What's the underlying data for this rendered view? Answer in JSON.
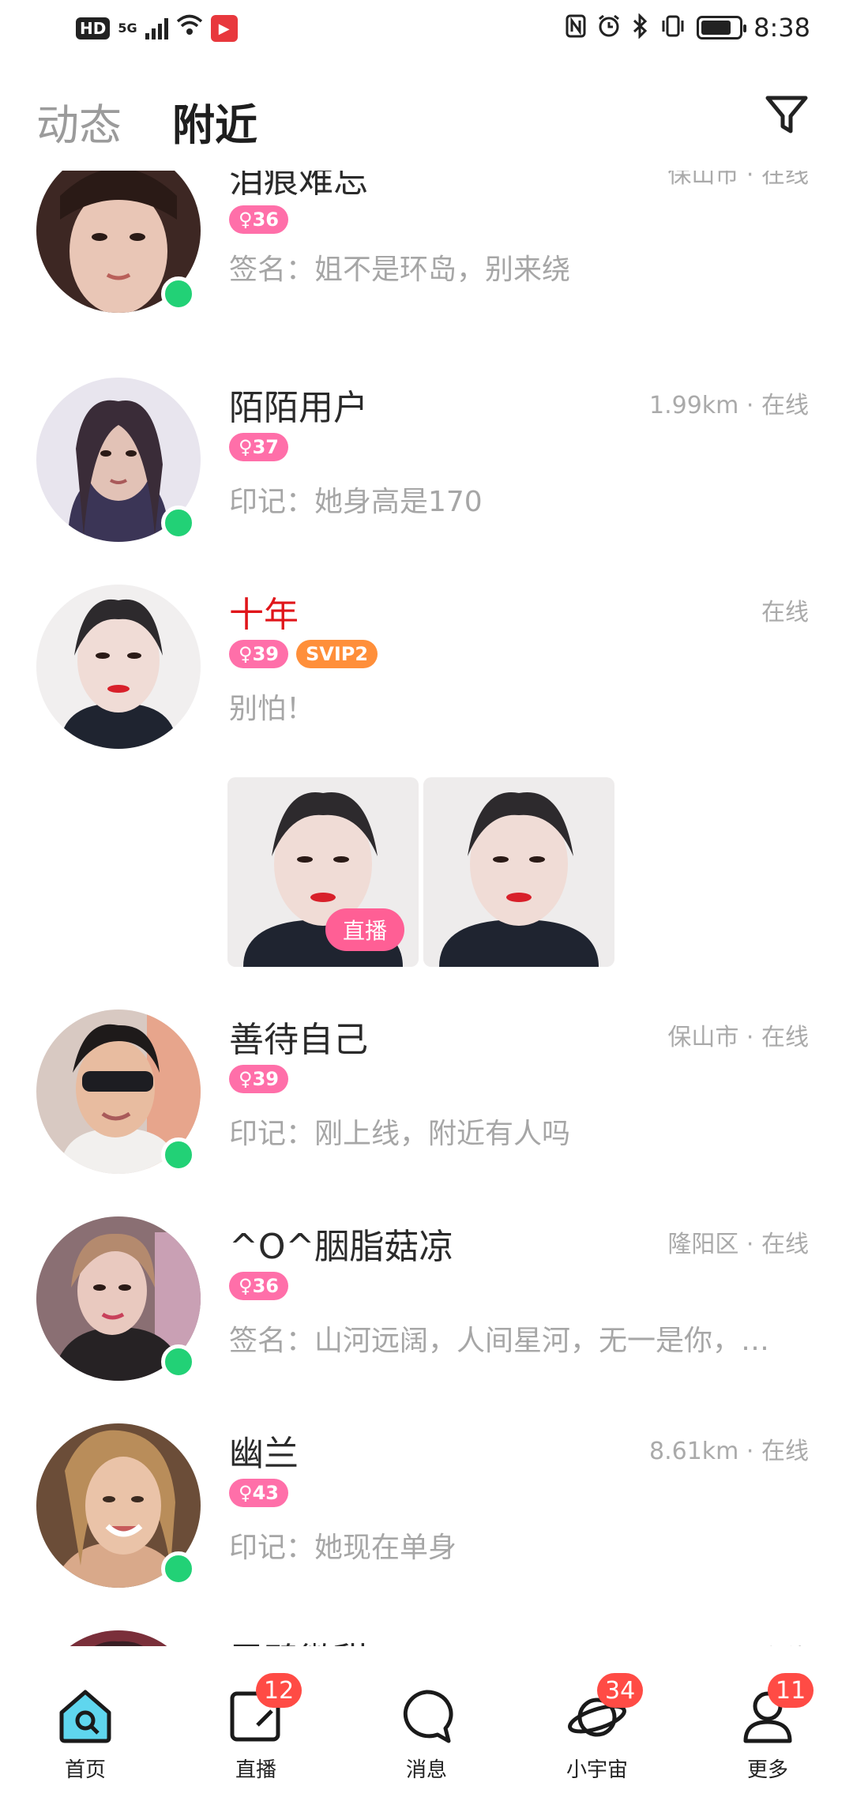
{
  "status_bar": {
    "hd": "HD",
    "network": "5G",
    "time": "8:38",
    "battery_level": 0.8
  },
  "header": {
    "tabs": [
      {
        "label": "动态",
        "active": false
      },
      {
        "label": "附近",
        "active": true
      }
    ],
    "filter_icon": "filter-funnel-icon"
  },
  "users": [
    {
      "name": "泪痕难忘",
      "location": "保山市 · 在线",
      "age": "36",
      "vip": "",
      "signature": "签名：姐不是环岛，别来绕",
      "online": true,
      "name_color": "#2a2a2a"
    },
    {
      "name": "陌陌用户",
      "location": "1.99km · 在线",
      "age": "37",
      "vip": "",
      "signature": "印记：她身高是170",
      "online": true,
      "name_color": "#2a2a2a"
    },
    {
      "name": "十年",
      "location": "在线",
      "age": "39",
      "vip": "SVIP2",
      "signature": "别怕！",
      "online": false,
      "name_color": "#e0151a",
      "live_label": "直播"
    },
    {
      "name": "善待自己",
      "location": "保山市 · 在线",
      "age": "39",
      "vip": "",
      "signature": "印记：刚上线，附近有人吗",
      "online": true,
      "name_color": "#2a2a2a"
    },
    {
      "name": "^O^胭脂菇凉",
      "location": "隆阳区 · 在线",
      "age": "36",
      "vip": "",
      "signature": "签名：山河远阔，人间星河，无一是你，…",
      "online": true,
      "name_color": "#2a2a2a"
    },
    {
      "name": "幽兰",
      "location": "8.61km · 在线",
      "age": "43",
      "vip": "",
      "signature": "印记：她现在单身",
      "online": true,
      "name_color": "#2a2a2a"
    },
    {
      "name": "雪碧微甜",
      "location": "在线",
      "age": "",
      "vip": "",
      "signature": "",
      "online": false,
      "name_color": "#2a2a2a"
    }
  ],
  "bottom_nav": [
    {
      "label": "首页",
      "icon": "home-icon",
      "badge": "",
      "active": true
    },
    {
      "label": "直播",
      "icon": "live-icon",
      "badge": "12",
      "active": false
    },
    {
      "label": "消息",
      "icon": "message-icon",
      "badge": "",
      "active": false
    },
    {
      "label": "小宇宙",
      "icon": "planet-icon",
      "badge": "34",
      "active": false
    },
    {
      "label": "更多",
      "icon": "profile-icon",
      "badge": "11",
      "active": false
    }
  ],
  "colors": {
    "online": "#22d176",
    "age_badge": "#ff6fa9",
    "vip_badge": "#ff8f3a",
    "nav_badge": "#ff4b45",
    "home_accent": "#5fd6ee"
  }
}
